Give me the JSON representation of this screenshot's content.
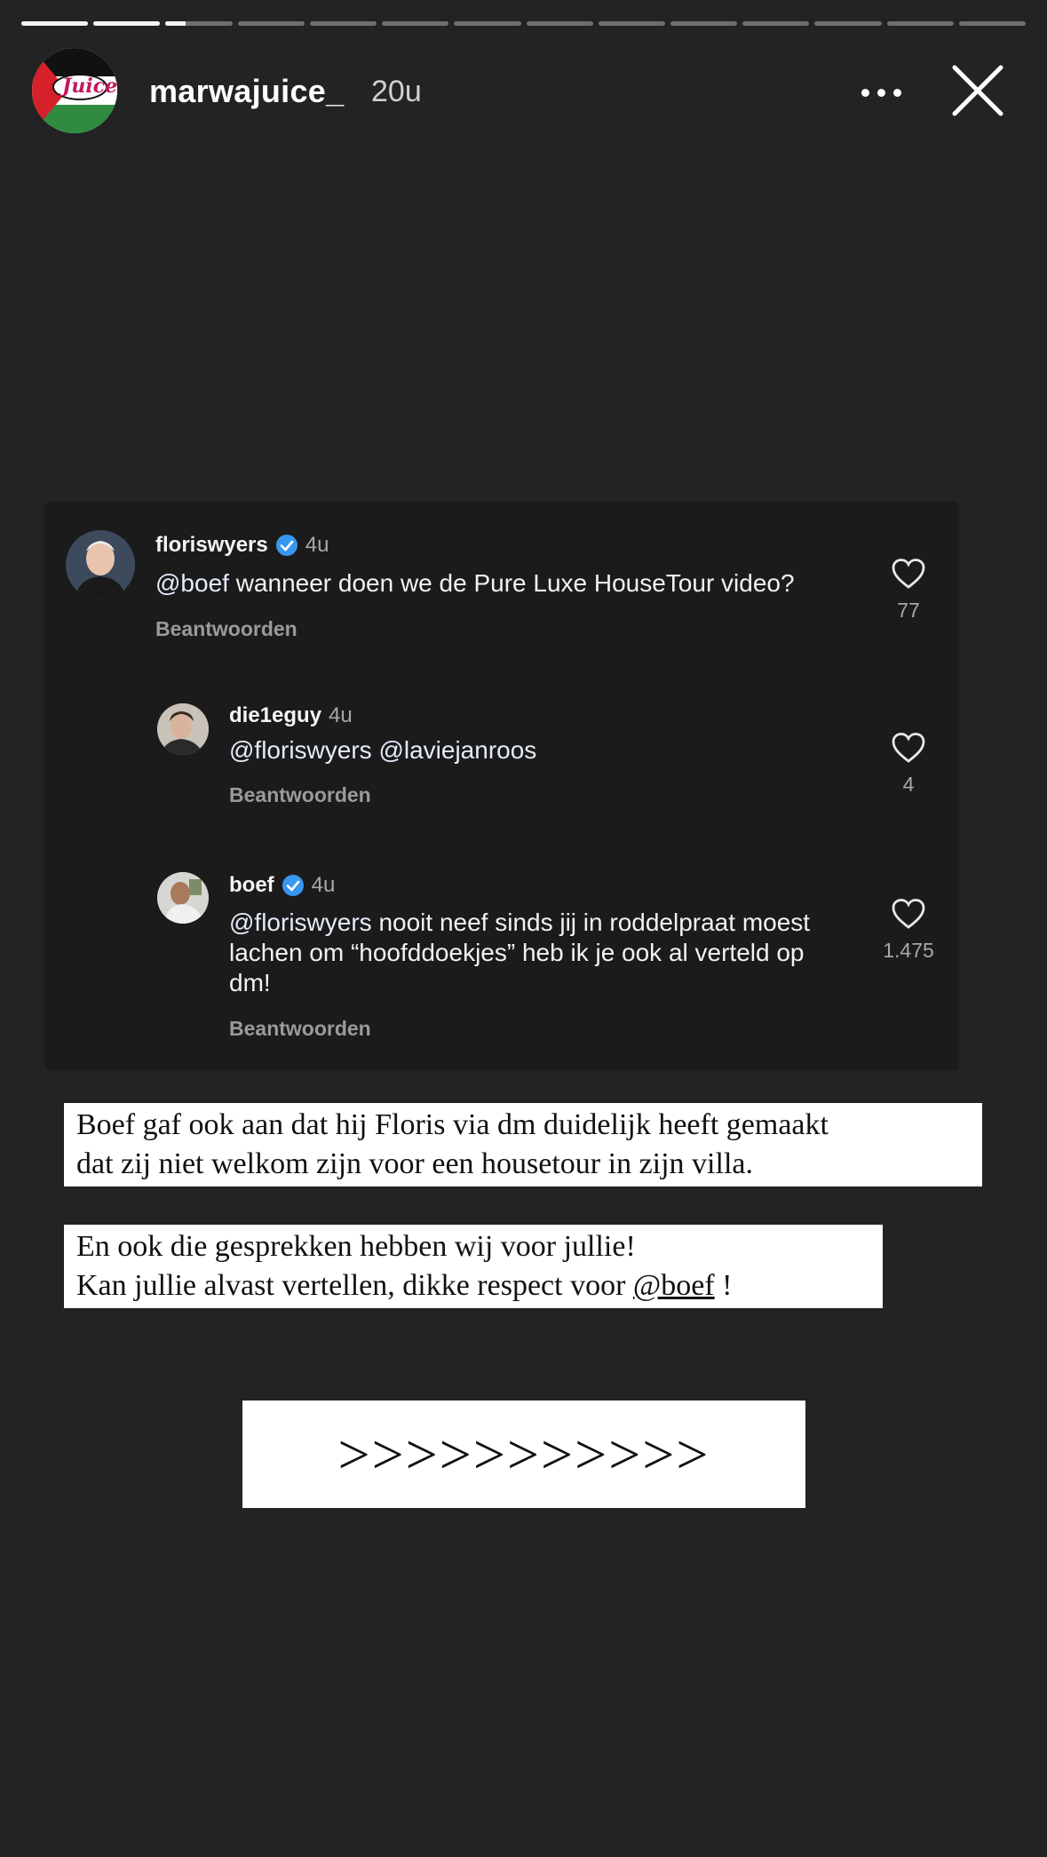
{
  "story": {
    "progress_segments": 14,
    "active_segment": 3,
    "active_fraction": 0.3,
    "username": "marwajuice_",
    "time_ago": "20u",
    "avatar_label": "Juice"
  },
  "comments": [
    {
      "user": "floriswyers",
      "verified": true,
      "time": "4u",
      "mention": "@boef",
      "text": " wanneer doen we de Pure Luxe HouseTour video?",
      "reply_label": "Beantwoorden",
      "likes": "77"
    },
    {
      "user": "die1eguy",
      "verified": false,
      "time": "4u",
      "mention": "@floriswyers @laviejanroos",
      "text": "",
      "reply_label": "Beantwoorden",
      "likes": "4"
    },
    {
      "user": "boef",
      "verified": true,
      "time": "4u",
      "mention": "@floriswyers",
      "text": " nooit neef sinds jij in roddelpraat moest lachen om “hoofddoekjes” heb ik je ook al verteld op dm!",
      "reply_label": "Beantwoorden",
      "likes": "1.475"
    }
  ],
  "captions": {
    "box1_line1": "Boef gaf ook aan dat hij Floris via dm duidelijk heeft gemaakt",
    "box1_line2": "dat zij niet welkom zijn voor een housetour in zijn villa.",
    "box2_line1": "En ook die gesprekken hebben wij voor jullie!",
    "box2_line2_pre": "Kan jullie alvast vertellen, dikke respect voor ",
    "box2_mention": "@boef",
    "box2_line2_post": " !",
    "arrows": ">>>>>>>>>>>"
  },
  "colors": {
    "background": "#232323",
    "card": "#1b1b1c",
    "verified_blue": "#3897f0"
  }
}
